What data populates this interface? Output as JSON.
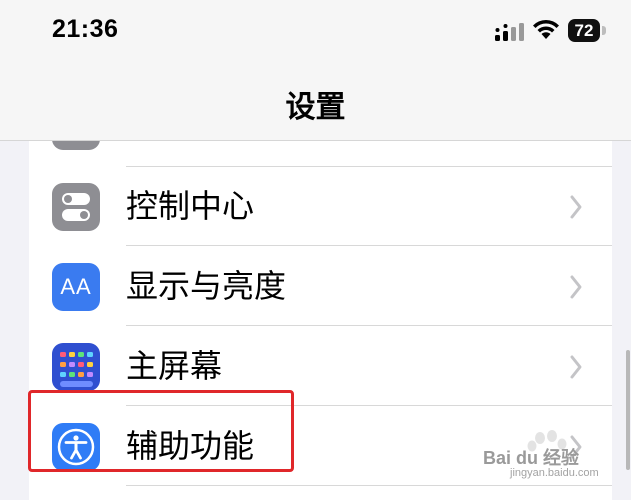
{
  "status_bar": {
    "time": "21:36",
    "battery_level": "72",
    "icons": [
      "cellular-signal-icon",
      "wifi-icon",
      "battery-icon"
    ]
  },
  "nav": {
    "title": "设置"
  },
  "settings": {
    "items": [
      {
        "label": "",
        "icon": "partial-item-icon",
        "color": "#8e8e93"
      },
      {
        "label": "控制中心",
        "icon": "control-center-icon",
        "color": "#8e8e93"
      },
      {
        "label": "显示与亮度",
        "icon": "display-brightness-icon",
        "icon_text": "AA",
        "color": "#3a7bf0"
      },
      {
        "label": "主屏幕",
        "icon": "home-screen-icon",
        "color": "#2f4fd0"
      },
      {
        "label": "辅助功能",
        "icon": "accessibility-icon",
        "color": "#2f7cf6"
      }
    ]
  },
  "watermark": {
    "text": "Bai du 经验",
    "sub": "jingyan.baidu.com"
  },
  "colors": {
    "highlight": "#e0272a",
    "background": "#f2f2f7"
  }
}
